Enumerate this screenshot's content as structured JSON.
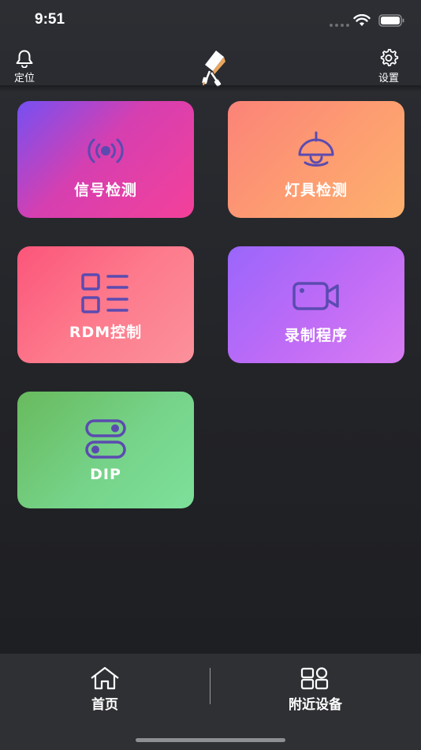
{
  "status_bar": {
    "time": "9:51"
  },
  "nav": {
    "left_label": "定位",
    "right_label": "设置",
    "left_icon": "bell-icon",
    "right_icon": "gear-icon",
    "logo_icon": "fixture-logo-icon"
  },
  "tiles": [
    {
      "label": "信号检测",
      "icon": "signal-icon"
    },
    {
      "label": "灯具检测",
      "icon": "lamp-icon"
    },
    {
      "label": "RDM控制",
      "icon": "list-icon"
    },
    {
      "label": "录制程序",
      "icon": "video-camera-icon"
    },
    {
      "label": "DIP",
      "icon": "toggle-switch-icon"
    }
  ],
  "tab_bar": {
    "items": [
      {
        "label": "首页",
        "icon": "home-icon"
      },
      {
        "label": "附近设备",
        "icon": "devices-icon"
      }
    ]
  },
  "colors": {
    "icon_purple": "#5b4bb0",
    "background": "#222327",
    "tab_bar": "#2f3034"
  }
}
